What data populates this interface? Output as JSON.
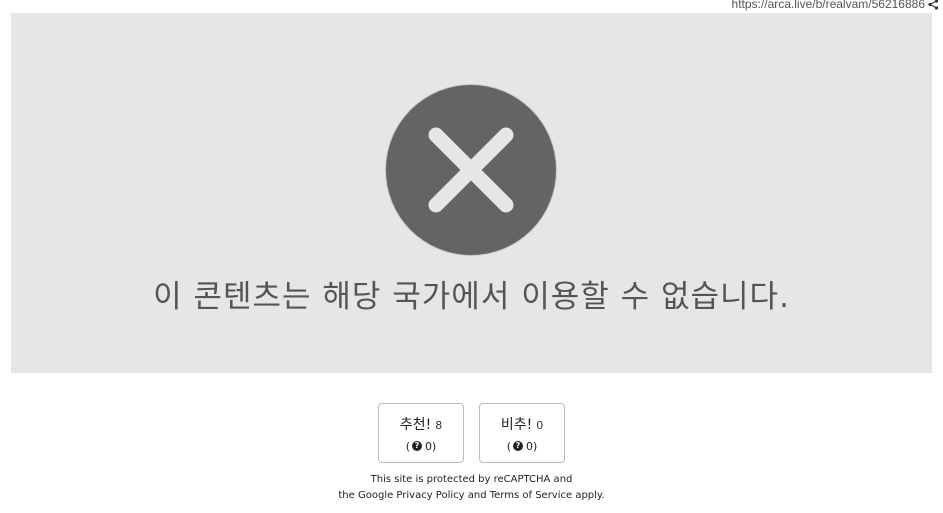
{
  "header": {
    "url": "https://arca.live/b/realvam/56216886",
    "share_icon": "share-icon"
  },
  "blocked": {
    "icon": "close-circle-icon",
    "message": "이 콘텐츠는 해당 국가에서 이용할 수 없습니다.",
    "panel_color": "#e6e6e6",
    "icon_color": "#646464"
  },
  "votes": {
    "upvote": {
      "label": "추천!",
      "count": "8",
      "open": "(",
      "sub_count": "0)"
    },
    "downvote": {
      "label": "비추!",
      "count": "0",
      "open": "(",
      "sub_count": "0)"
    }
  },
  "recaptcha": {
    "line1": "This site is protected by reCAPTCHA and",
    "line2": "the Google Privacy Policy and Terms of Service apply."
  }
}
